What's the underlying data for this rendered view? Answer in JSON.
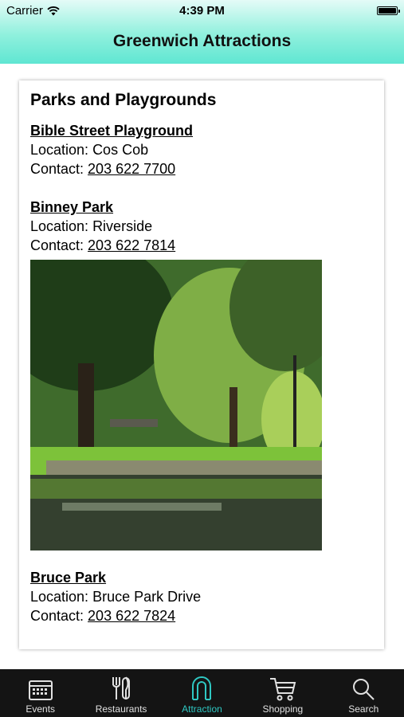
{
  "status": {
    "carrier": "Carrier",
    "time": "4:39 PM"
  },
  "nav": {
    "title": "Greenwich Attractions"
  },
  "section": {
    "heading": "Parks and Playgrounds",
    "entries": [
      {
        "name": "Bible Street Playground",
        "location_label": "Location: ",
        "location": "Cos Cob",
        "contact_label": "Contact: ",
        "phone": "203 622 7700"
      },
      {
        "name": "Binney Park",
        "location_label": "Location: ",
        "location": "Riverside",
        "contact_label": "Contact: ",
        "phone": "203 622 7814"
      },
      {
        "name": "Bruce Park",
        "location_label": "Location: ",
        "location": "Bruce Park Drive",
        "contact_label": "Contact: ",
        "phone": "203 622 7824"
      }
    ]
  },
  "tabs": [
    {
      "label": "Events",
      "icon": "calendar-icon"
    },
    {
      "label": "Restaurants",
      "icon": "fork-knife-icon"
    },
    {
      "label": "Attraction",
      "icon": "magnet-icon",
      "active": true
    },
    {
      "label": "Shopping",
      "icon": "cart-icon"
    },
    {
      "label": "Search",
      "icon": "search-icon"
    }
  ],
  "colors": {
    "accent": "#2fc7c2",
    "tab_bg": "#141414",
    "header_top": "#e4fbf7",
    "header_bottom": "#5fe6d2"
  }
}
